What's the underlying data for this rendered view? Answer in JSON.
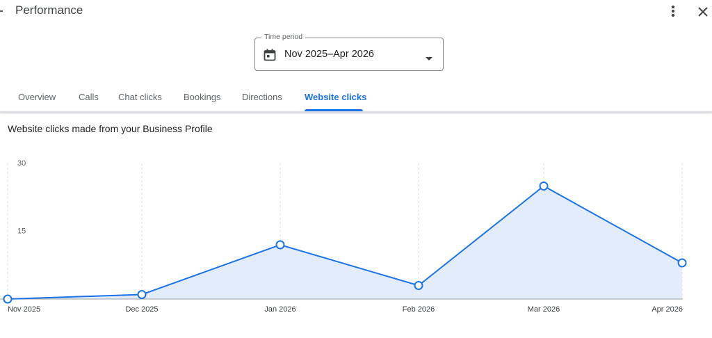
{
  "header": {
    "title": "Performance",
    "more_icon": "more-vert-icon",
    "close_icon": "close-icon"
  },
  "time_period": {
    "label": "Time period",
    "value": "Nov 2025–Apr 2026",
    "icon": "calendar-icon"
  },
  "tabs": [
    {
      "label": "Overview",
      "active": false
    },
    {
      "label": "Calls",
      "active": false
    },
    {
      "label": "Chat clicks",
      "active": false
    },
    {
      "label": "Bookings",
      "active": false
    },
    {
      "label": "Directions",
      "active": false
    },
    {
      "label": "Website clicks",
      "active": true
    }
  ],
  "chart_section": {
    "subtitle": "Website clicks made from your Business Profile"
  },
  "chart_data": {
    "type": "area",
    "categories": [
      "Nov 2025",
      "Dec 2025",
      "Jan 2026",
      "Feb 2026",
      "Mar 2026",
      "Apr 2026"
    ],
    "values": [
      0,
      1,
      12,
      3,
      25,
      8
    ],
    "ylim": [
      0,
      30
    ],
    "yticks": [
      15,
      30
    ],
    "grid": true,
    "colors": {
      "line": "#1a73e8",
      "fill": "#e3ecfa"
    }
  }
}
